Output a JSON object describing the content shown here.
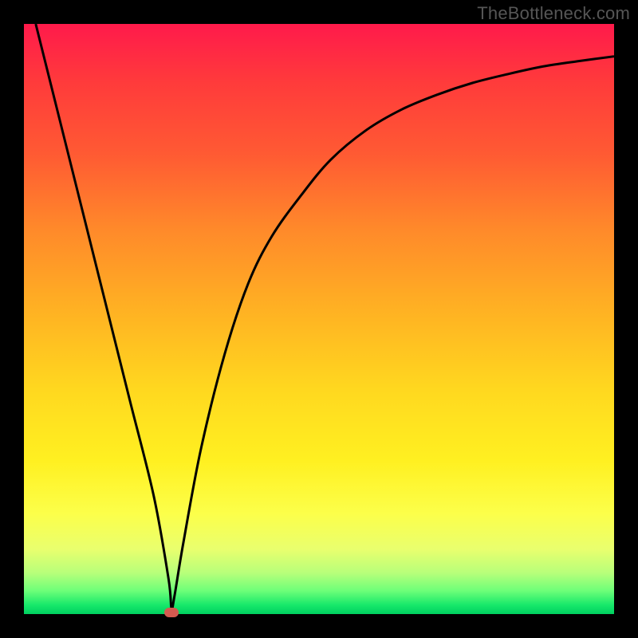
{
  "attribution": "TheBottleneck.com",
  "chart_data": {
    "type": "line",
    "title": "",
    "xlabel": "",
    "ylabel": "",
    "xlim": [
      0,
      100
    ],
    "ylim": [
      0,
      100
    ],
    "grid": false,
    "legend": false,
    "series": [
      {
        "name": "curve",
        "x": [
          2,
          5,
          10,
          14,
          18,
          22,
          24.5,
          25,
          25.5,
          27,
          30,
          34,
          38,
          42,
          47,
          52,
          58,
          64,
          70,
          76,
          82,
          88,
          94,
          100
        ],
        "values": [
          100,
          88,
          68,
          52,
          36,
          20,
          6,
          1,
          3,
          12,
          28,
          44,
          56,
          64,
          71,
          77,
          82,
          85.5,
          88,
          90,
          91.5,
          92.8,
          93.7,
          94.5
        ]
      }
    ],
    "marker": {
      "x": 25,
      "y": 0
    },
    "gradient_stops": [
      {
        "pos": 0,
        "color": "#ff1a4b"
      },
      {
        "pos": 0.1,
        "color": "#ff3b3b"
      },
      {
        "pos": 0.22,
        "color": "#ff5a33"
      },
      {
        "pos": 0.35,
        "color": "#ff8a2a"
      },
      {
        "pos": 0.48,
        "color": "#ffb023"
      },
      {
        "pos": 0.62,
        "color": "#ffd81f"
      },
      {
        "pos": 0.74,
        "color": "#fff021"
      },
      {
        "pos": 0.83,
        "color": "#fcff4a"
      },
      {
        "pos": 0.89,
        "color": "#e9ff6e"
      },
      {
        "pos": 0.93,
        "color": "#b8ff7a"
      },
      {
        "pos": 0.96,
        "color": "#6fff79"
      },
      {
        "pos": 0.985,
        "color": "#16e86a"
      },
      {
        "pos": 1.0,
        "color": "#00d060"
      }
    ]
  }
}
